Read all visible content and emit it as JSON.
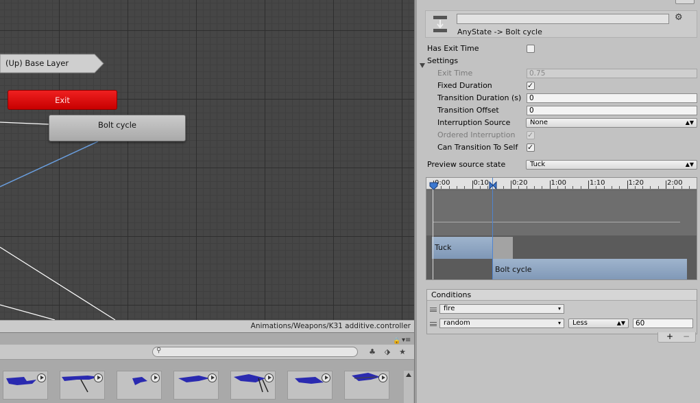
{
  "graph": {
    "base_layer_label": "(Up) Base Layer",
    "exit_label": "Exit",
    "state_label": "Bolt cycle",
    "footer_path": "Animations/Weapons/K31 additive.controller",
    "colors": {
      "exit": "#e01010",
      "transition_line_selected": "#6a9fe0",
      "transition_line": "#ffffff"
    }
  },
  "inspector": {
    "header_title": "AnyState -> Bolt cycle",
    "name_value": "",
    "has_exit_time_label": "Has Exit Time",
    "settings_label": "Settings",
    "exit_time": {
      "label": "Exit Time",
      "value": "0.75"
    },
    "fixed_duration_label": "Fixed Duration",
    "transition_duration": {
      "label": "Transition Duration (s)",
      "value": "0"
    },
    "transition_offset": {
      "label": "Transition Offset",
      "value": "0"
    },
    "interruption_source": {
      "label": "Interruption Source",
      "value": "None"
    },
    "ordered_interruption_label": "Ordered Interruption",
    "can_transition_label": "Can Transition To Self",
    "preview_source": {
      "label": "Preview source state",
      "value": "Tuck"
    },
    "checkbox_states": {
      "has_exit_time": false,
      "fixed_duration": true,
      "ordered_interruption": true,
      "can_transition_to_self": true
    }
  },
  "timeline": {
    "ticks": [
      "0:00",
      "0:10",
      "0:20",
      "1:00",
      "1:10",
      "1:20",
      "2:00"
    ],
    "source_clip": "Tuck",
    "dest_clip": "Bolt cycle",
    "colors": {
      "clip": "#8ea5c2",
      "marker": "#3b78d0"
    }
  },
  "conditions": {
    "title": "Conditions",
    "items": [
      {
        "param": "fire"
      },
      {
        "param": "random",
        "mode": "Less",
        "value": "60"
      }
    ],
    "add_label": "+",
    "remove_label": "−"
  },
  "icons": [
    "lock-icon",
    "menu-icon",
    "search-icon",
    "gear-icon",
    "transition-icon",
    "play-icon"
  ]
}
